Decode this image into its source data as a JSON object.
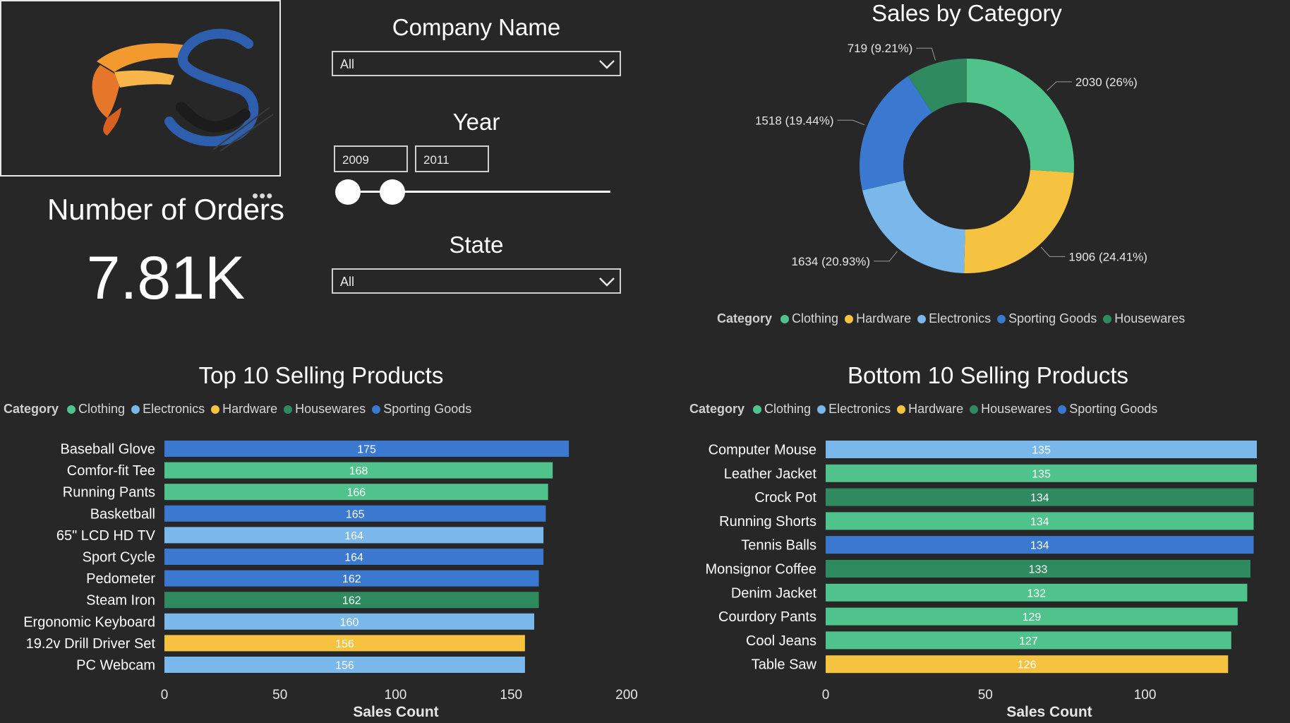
{
  "colors": {
    "background": "#272727",
    "Clothing": "#4fc38b",
    "Hardware": "#f6c341",
    "Electronics": "#7ab8ec",
    "Sporting Goods": "#3b78d0",
    "Housewares": "#2f8a60"
  },
  "kpi": {
    "title": "Number of Orders",
    "value": "7.81K",
    "menu": "•••"
  },
  "slicers": {
    "company": {
      "title": "Company Name",
      "value": "All"
    },
    "year": {
      "title": "Year",
      "from": "2009",
      "to": "2011",
      "range_from_fraction": 0.0,
      "range_to_fraction": 0.17
    },
    "state": {
      "title": "State",
      "value": "All"
    }
  },
  "chart_data": [
    {
      "type": "pie",
      "variant": "donut",
      "title": "Sales by Category",
      "legend_title": "Category",
      "legend_order": [
        "Clothing",
        "Hardware",
        "Electronics",
        "Sporting Goods",
        "Housewares"
      ],
      "slices": [
        {
          "name": "Clothing",
          "value": 2030,
          "label": "2030 (26%)"
        },
        {
          "name": "Hardware",
          "value": 1906,
          "label": "1906 (24.41%)"
        },
        {
          "name": "Electronics",
          "value": 1634,
          "label": "1634 (20.93%)"
        },
        {
          "name": "Sporting Goods",
          "value": 1518,
          "label": "1518 (19.44%)"
        },
        {
          "name": "Housewares",
          "value": 719,
          "label": "719 (9.21%)"
        }
      ]
    },
    {
      "type": "bar",
      "orientation": "horizontal",
      "title": "Top 10 Selling Products",
      "legend_title": "Category",
      "legend_order": [
        "Clothing",
        "Electronics",
        "Hardware",
        "Housewares",
        "Sporting Goods"
      ],
      "xlabel": "Sales Count",
      "xlim": [
        0,
        200
      ],
      "xticks": [
        0,
        50,
        100,
        150,
        200
      ],
      "categories": [
        "Baseball Glove",
        "Comfor-fit Tee",
        "Running Pants",
        "Basketball",
        "65\" LCD HD TV",
        "Sport Cycle",
        "Pedometer",
        "Steam Iron",
        "Ergonomic Keyboard",
        "19.2v Drill Driver Set",
        "PC Webcam"
      ],
      "values": [
        175,
        168,
        166,
        165,
        164,
        164,
        162,
        162,
        160,
        156,
        156
      ],
      "bar_categories": [
        "Sporting Goods",
        "Clothing",
        "Clothing",
        "Sporting Goods",
        "Electronics",
        "Sporting Goods",
        "Sporting Goods",
        "Housewares",
        "Electronics",
        "Hardware",
        "Electronics"
      ]
    },
    {
      "type": "bar",
      "orientation": "horizontal",
      "title": "Bottom 10 Selling Products",
      "legend_title": "Category",
      "legend_order": [
        "Clothing",
        "Electronics",
        "Hardware",
        "Housewares",
        "Sporting Goods"
      ],
      "xlabel": "Sales Count",
      "xlim": [
        0,
        135
      ],
      "xticks": [
        0,
        50,
        100
      ],
      "categories": [
        "Computer Mouse",
        "Leather Jacket",
        "Crock Pot",
        "Running Shorts",
        "Tennis Balls",
        "Monsignor Coffee",
        "Denim Jacket",
        "Courdory Pants",
        "Cool Jeans",
        "Table Saw"
      ],
      "values": [
        135,
        135,
        134,
        134,
        134,
        133,
        132,
        129,
        127,
        126
      ],
      "bar_categories": [
        "Electronics",
        "Clothing",
        "Housewares",
        "Clothing",
        "Sporting Goods",
        "Housewares",
        "Clothing",
        "Clothing",
        "Clothing",
        "Hardware"
      ]
    }
  ]
}
